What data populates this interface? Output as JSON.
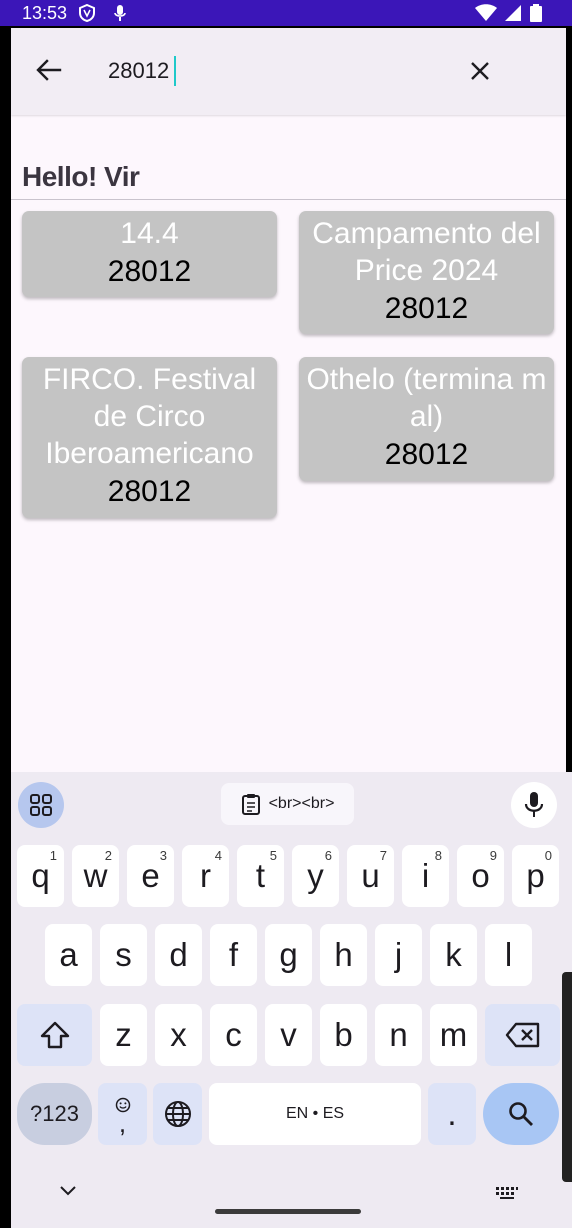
{
  "status_bar": {
    "time": "13:53"
  },
  "search": {
    "query": "28012"
  },
  "greeting": "Hello! Vir",
  "cards": [
    {
      "title": "14.4",
      "code": "28012"
    },
    {
      "title": "Campamento del Price 2024",
      "code": "28012"
    },
    {
      "title": "FIRCO. Festival de Circo Iberoamericano",
      "code": "28012"
    },
    {
      "title": "Othelo (termina mal)",
      "code": "28012"
    }
  ],
  "keyboard": {
    "clipboard": "<br><br>",
    "row1": [
      {
        "key": "q",
        "sup": "1"
      },
      {
        "key": "w",
        "sup": "2"
      },
      {
        "key": "e",
        "sup": "3"
      },
      {
        "key": "r",
        "sup": "4"
      },
      {
        "key": "t",
        "sup": "5"
      },
      {
        "key": "y",
        "sup": "6"
      },
      {
        "key": "u",
        "sup": "7"
      },
      {
        "key": "i",
        "sup": "8"
      },
      {
        "key": "o",
        "sup": "9"
      },
      {
        "key": "p",
        "sup": "0"
      }
    ],
    "row2": [
      "a",
      "s",
      "d",
      "f",
      "g",
      "h",
      "j",
      "k",
      "l"
    ],
    "row3": [
      "z",
      "x",
      "c",
      "v",
      "b",
      "n",
      "m"
    ],
    "symbols_label": "?123",
    "emoji_comma": ",",
    "space_label": "EN • ES",
    "period": "."
  },
  "colors": {
    "status_bar": "#3b16b8",
    "card_bg": "#c4c4c4",
    "app_bg": "#fdf7fd",
    "search_bar": "#f2edf4",
    "caret": "#1fc9c9",
    "keyboard_bg": "#eeeaf2",
    "search_key": "#a8c6f4"
  }
}
